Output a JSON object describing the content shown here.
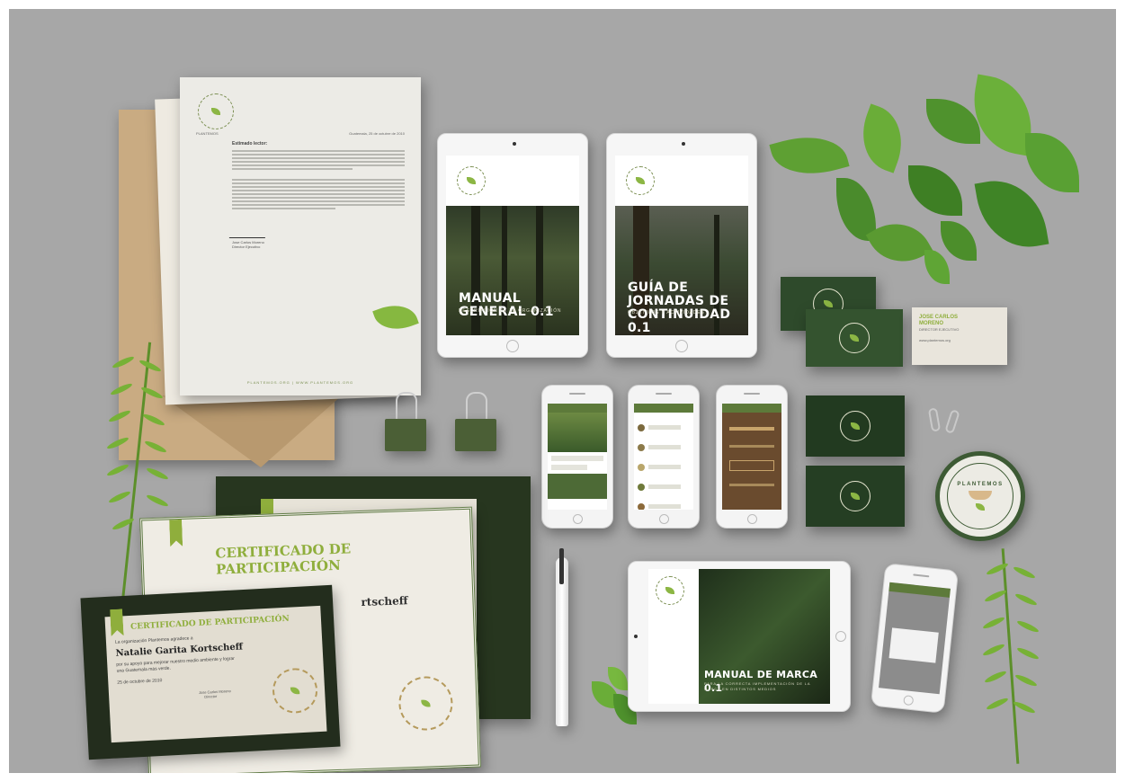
{
  "brand": {
    "name": "PLANTEMOS",
    "slogan": "PLANTEMOS · PLANTEMOS",
    "accent": "#8fae3c",
    "dark_green": "#3d5a34",
    "background": "#a7a7a7"
  },
  "letterhead": {
    "date": "Guatemala, 25 de octubre de 2010",
    "greeting": "Estimado lector:",
    "signer": "Jose Carlos Moreno",
    "role": "Director Ejecutivo",
    "footer": "PLANTEMOS.ORG  |  WWW.PLANTEMOS.ORG"
  },
  "tablets": [
    {
      "title": "MANUAL GENERAL 0.1",
      "subtitle": "DESCRIPCIÓN DE LA ORGANIZACIÓN"
    },
    {
      "title": "GUÍA DE JORNADAS DE CONTINUIDAD 0.1",
      "subtitle": "OBJETIVOS Y ACTIVIDADES"
    },
    {
      "title": "MANUAL DE MARCA 0.1",
      "subtitle": "PARA LA CORRECTA IMPLEMENTACIÓN DE LA MARCA EN DISTINTOS MEDIOS"
    }
  ],
  "business_card": {
    "name": "JOSE CARLOS MORENO",
    "role": "DIRECTOR EJECUTIVO",
    "site": "www.plantemos.org"
  },
  "seal": {
    "text": "PLANTEMOS"
  },
  "certificates": {
    "title": "CERTIFICADO DE PARTICIPACIÓN",
    "intro": "La organización Plantemos agradece a",
    "recipient": "Natalie Garita Kortscheff",
    "reason": "por su apoyo para mejorar nuestro medio ambiente y lograr una Guatemala más verde.",
    "date": "25 de octubre de 2010",
    "signer": "Jose Carlos Moreno",
    "signer_role": "Director",
    "back_fragment_name": "rtscheff"
  }
}
